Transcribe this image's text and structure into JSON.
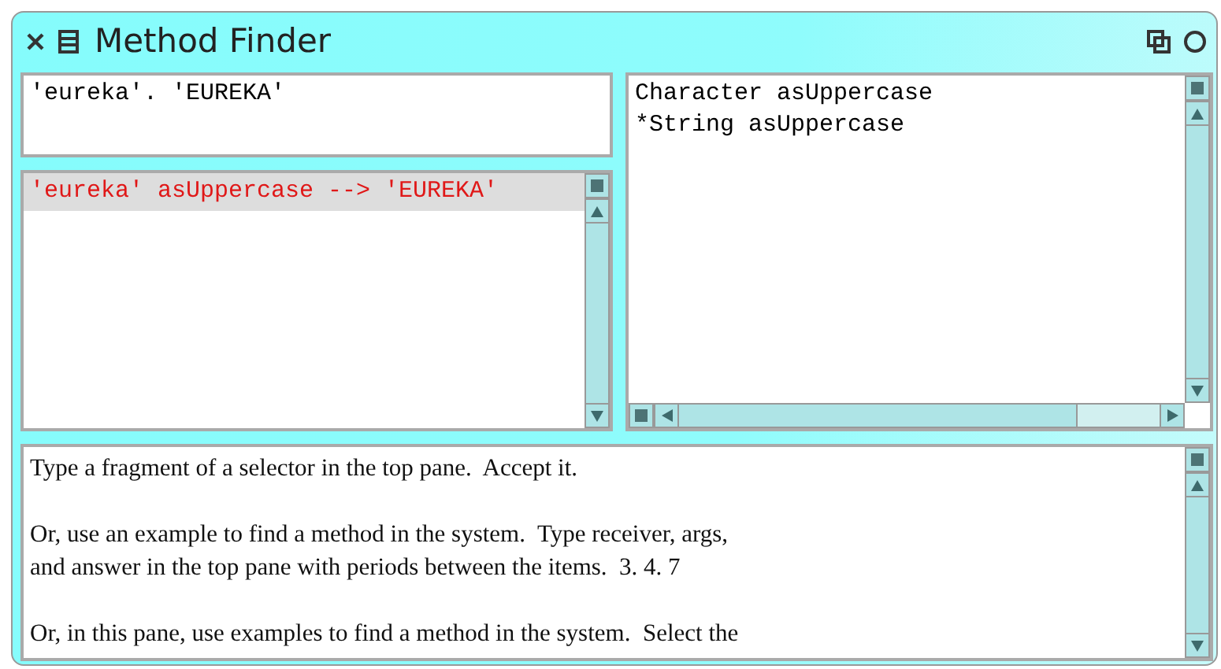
{
  "window": {
    "title": "Method Finder"
  },
  "input_pane": {
    "text": "'eureka'. 'EUREKA'"
  },
  "results": [
    {
      "text": "'eureka' asUppercase --> 'EUREKA'",
      "selected": true
    }
  ],
  "implementors": [
    {
      "text": "Character asUppercase"
    },
    {
      "text": "*String asUppercase"
    }
  ],
  "help_text": [
    [
      "Type a fragment of a selector in the top pane.  Accept it."
    ],
    [
      "Or, use an example to find a method in the system.  Type receiver, args,",
      "and answer in the top pane with periods between the items.  3. 4. 7"
    ],
    [
      "Or, in this pane, use examples to find a method in the system.  Select the"
    ]
  ]
}
